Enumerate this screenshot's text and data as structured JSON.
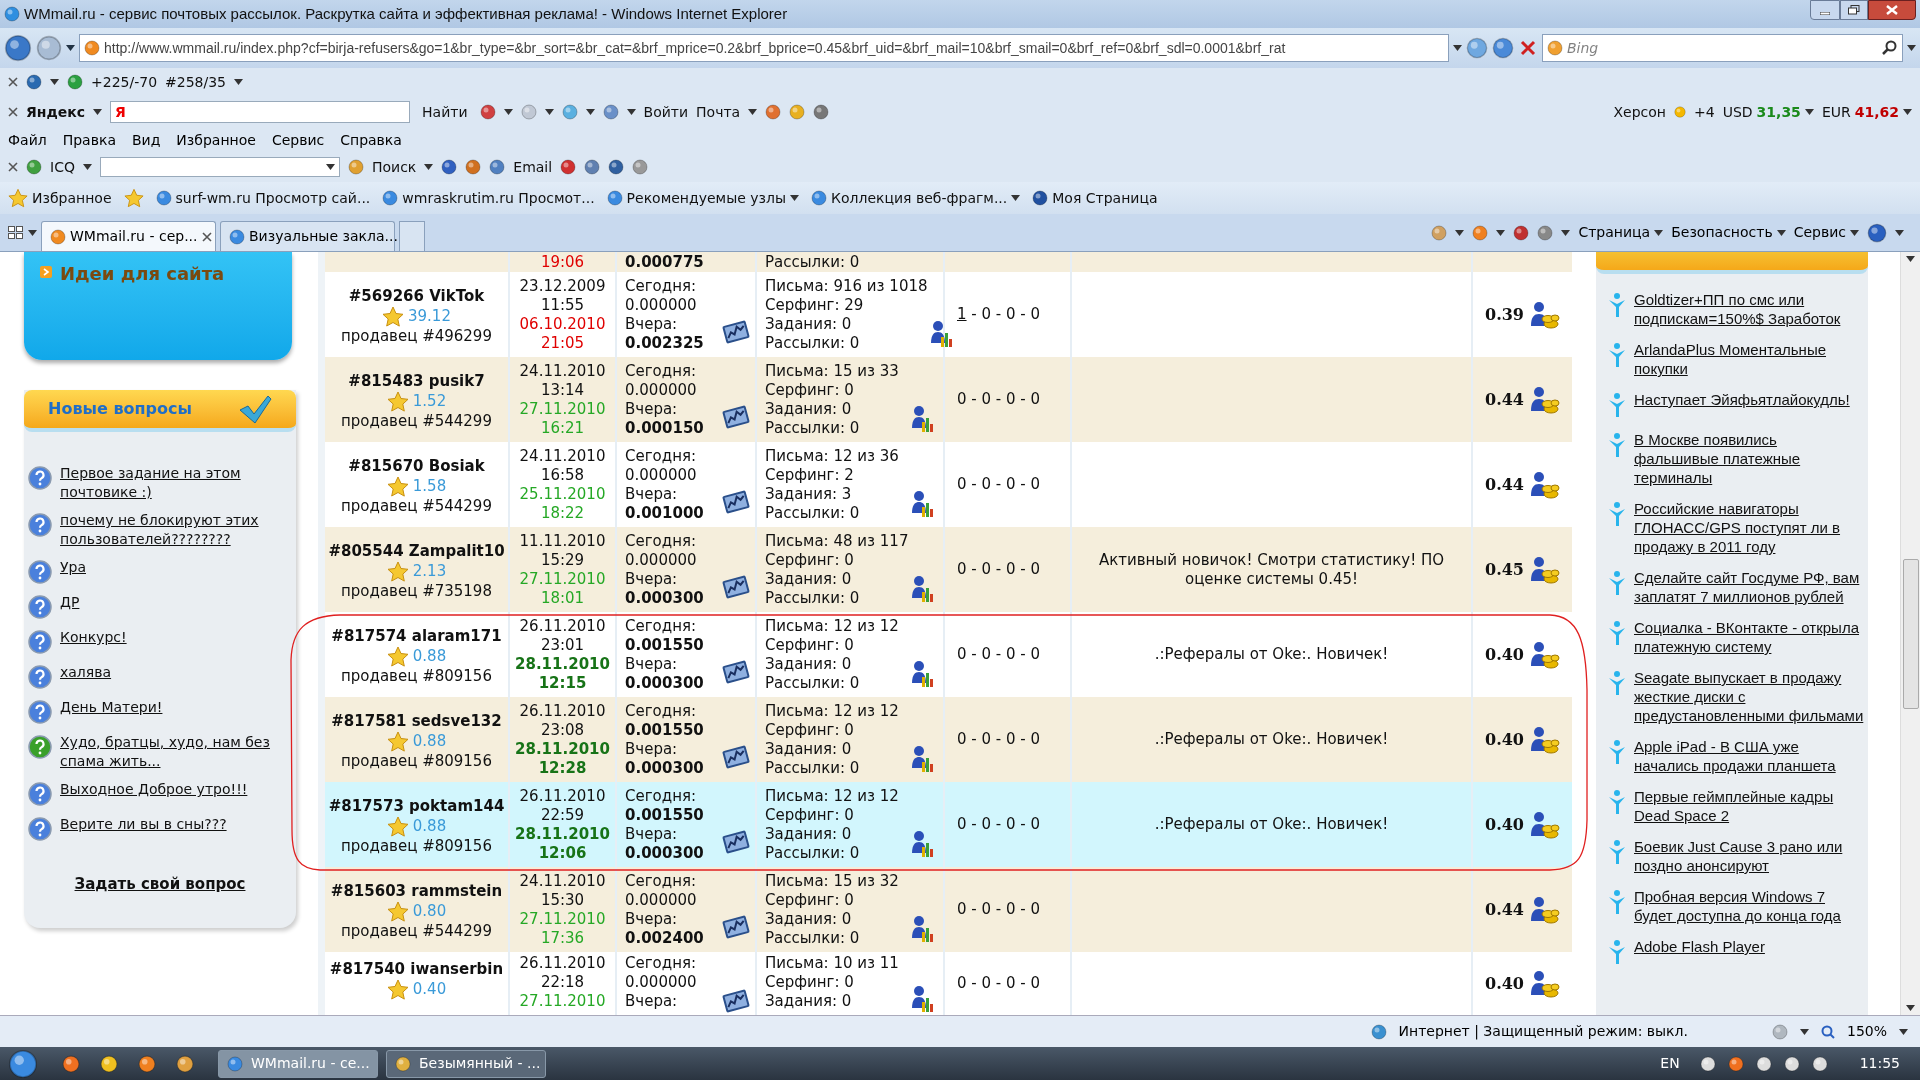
{
  "window": {
    "title": "WMmail.ru - сервис почтовых рассылок. Раскрутка сайта и эффективная реклама! - Windows Internet Explorer"
  },
  "address_bar": {
    "url": "http://www.wmmail.ru/index.php?cf=birja-refusers&go=1&br_type=&br_sort=&br_cat=&brf_mprice=0.2&brf_bprice=0.45&brf_uid=&brf_mail=10&brf_smail=0&brf_ref=0&brf_sdl=0.0001&brf_rat",
    "search_placeholder": "Bing"
  },
  "counter_bar": {
    "counters": [
      "+225/-70",
      "#258/35"
    ]
  },
  "yandex_bar": {
    "logo": "Яндекс",
    "field_logo": "Я",
    "search_button": "Найти",
    "buttons": [
      "Войти",
      "Почта"
    ],
    "city": "Херсон",
    "weather": "+4",
    "currencies": [
      {
        "code": "USD",
        "value": "31,35",
        "color": "#1a8a1a"
      },
      {
        "code": "EUR",
        "value": "41,62",
        "color": "#c00000"
      }
    ]
  },
  "menu": [
    "Файл",
    "Правка",
    "Вид",
    "Избранное",
    "Сервис",
    "Справка"
  ],
  "icq_bar": {
    "label": "ICQ",
    "search": "Поиск",
    "email": "Email"
  },
  "favorites_bar": {
    "label": "Избранное",
    "items": [
      {
        "text": "surf-wm.ru Просмотр сай...",
        "dropdown": false
      },
      {
        "text": "wmraskrutim.ru Просмот...",
        "dropdown": false
      },
      {
        "text": "Рекомендуемые узлы",
        "dropdown": true
      },
      {
        "text": "Коллекция веб-фрагм...",
        "dropdown": true
      },
      {
        "text": "Моя Страница",
        "dropdown": false
      }
    ]
  },
  "tabs": [
    {
      "label": "WMmail.ru - сер...",
      "selected": true
    },
    {
      "label": "Визуальные закла...",
      "selected": false
    }
  ],
  "command_bar": [
    "Страница",
    "Безопасность",
    "Сервис"
  ],
  "left_sidebar": {
    "banner": "Идеи для сайта",
    "questions": {
      "title": "Новые вопросы",
      "items": [
        {
          "text": "Первое задание на этом почтовике :)",
          "color": "#4a80dc"
        },
        {
          "text": "почему не блокируют этих пользователей????????",
          "color": "#4a80dc"
        },
        {
          "text": "Ура",
          "color": "#4a80dc"
        },
        {
          "text": "ДР",
          "color": "#4a80dc"
        },
        {
          "text": "Конкурс!",
          "color": "#4a80dc"
        },
        {
          "text": "халява",
          "color": "#4a80dc"
        },
        {
          "text": "День Матери!",
          "color": "#4a80dc"
        },
        {
          "text": "Худо, братцы, худо, нам без спама жить...",
          "color": "#3aa02a"
        },
        {
          "text": "Выходное Доброе утро!!!",
          "color": "#4a80dc"
        },
        {
          "text": "Верите ли вы в сны???",
          "color": "#4a80dc"
        }
      ],
      "ask_link": "Задать свой вопрос"
    }
  },
  "table": {
    "rows": [
      {
        "kind": "top",
        "selected": false,
        "last": [
          "19:06"
        ],
        "color": "#e00000",
        "last_bold": false,
        "yesterday": "0.000775",
        "letters": [
          "Рассылки: 0"
        ]
      },
      {
        "kind": "full",
        "selected": false,
        "user": "#569266 VikTok",
        "rating": "39.12",
        "seller": "продавец #496299",
        "created": [
          "23.12.2009",
          "11:55"
        ],
        "last": [
          "06.10.2010",
          "21:05"
        ],
        "color": "#e00000",
        "last_bold": false,
        "today_label": "Сегодня:",
        "today": "0.000000",
        "today_bold": false,
        "yesterday_label": "Вчера:",
        "yesterday": "0.002325",
        "letters": [
          "Письма: 916 из 1018",
          "Серфинг: 29",
          "Задания: 0",
          "Рассылки: 0"
        ],
        "stats": {
          "link": "1",
          "rest": " - 0 - 0 - 0"
        },
        "price": "0.39"
      },
      {
        "kind": "full",
        "selected": false,
        "user": "#815483 pusik7",
        "rating": "1.52",
        "seller": "продавец #544299",
        "created": [
          "24.11.2010",
          "13:14"
        ],
        "last": [
          "27.11.2010",
          "16:21"
        ],
        "color": "#25a825",
        "last_bold": false,
        "today_label": "Сегодня:",
        "today": "0.000000",
        "today_bold": false,
        "yesterday_label": "Вчера:",
        "yesterday": "0.000150",
        "letters": [
          "Письма: 15 из 33",
          "Серфинг: 0",
          "Задания: 0",
          "Рассылки: 0"
        ],
        "stats": {
          "rest": "0 - 0 - 0 - 0"
        },
        "price": "0.44"
      },
      {
        "kind": "full",
        "selected": false,
        "user": "#815670 Bosiak",
        "rating": "1.58",
        "seller": "продавец #544299",
        "created": [
          "24.11.2010",
          "16:58"
        ],
        "last": [
          "25.11.2010",
          "18:22"
        ],
        "color": "#25a825",
        "last_bold": false,
        "today_label": "Сегодня:",
        "today": "0.000000",
        "today_bold": false,
        "yesterday_label": "Вчера:",
        "yesterday": "0.001000",
        "letters": [
          "Письма: 12 из 36",
          "Серфинг: 2",
          "Задания: 3",
          "Рассылки: 0"
        ],
        "stats": {
          "rest": "0 - 0 - 0 - 0"
        },
        "price": "0.44"
      },
      {
        "kind": "full",
        "selected": false,
        "user": "#805544 Zampalit10",
        "rating": "2.13",
        "seller": "продавец #735198",
        "created": [
          "11.11.2010",
          "15:29"
        ],
        "last": [
          "27.11.2010",
          "18:01"
        ],
        "color": "#25a825",
        "last_bold": false,
        "today_label": "Сегодня:",
        "today": "0.000000",
        "today_bold": false,
        "yesterday_label": "Вчера:",
        "yesterday": "0.000300",
        "letters": [
          "Письма: 48 из 117",
          "Серфинг: 0",
          "Задания: 0",
          "Рассылки: 0"
        ],
        "stats": {
          "rest": "0 - 0 - 0 - 0"
        },
        "comment": "Активный новичок! Смотри статистику! ПО оценке системы 0.45!",
        "price": "0.45"
      },
      {
        "kind": "full",
        "selected": false,
        "user": "#817574 alaram171",
        "rating": "0.88",
        "seller": "продавец #809156",
        "created": [
          "26.11.2010",
          "23:01"
        ],
        "last": [
          "28.11.2010",
          "12:15"
        ],
        "color": "#177317",
        "last_bold": true,
        "today_label": "Сегодня:",
        "today": "0.001550",
        "today_bold": true,
        "yesterday_label": "Вчера:",
        "yesterday": "0.000300",
        "letters": [
          "Письма: 12 из 12",
          "Серфинг: 0",
          "Задания: 0",
          "Рассылки: 0"
        ],
        "stats": {
          "rest": "0 - 0 - 0 - 0"
        },
        "comment": ".:Рефералы от Oke:. Новичек!",
        "price": "0.40"
      },
      {
        "kind": "full",
        "selected": false,
        "user": "#817581 sedsve132",
        "rating": "0.88",
        "seller": "продавец #809156",
        "created": [
          "26.11.2010",
          "23:08"
        ],
        "last": [
          "28.11.2010",
          "12:28"
        ],
        "color": "#177317",
        "last_bold": true,
        "today_label": "Сегодня:",
        "today": "0.001550",
        "today_bold": true,
        "yesterday_label": "Вчера:",
        "yesterday": "0.000300",
        "letters": [
          "Письма: 12 из 12",
          "Серфинг: 0",
          "Задания: 0",
          "Рассылки: 0"
        ],
        "stats": {
          "rest": "0 - 0 - 0 - 0"
        },
        "comment": ".:Рефералы от Oke:. Новичек!",
        "price": "0.40"
      },
      {
        "kind": "full",
        "selected": true,
        "user": "#817573 poktam144",
        "rating": "0.88",
        "seller": "продавец #809156",
        "created": [
          "26.11.2010",
          "22:59"
        ],
        "last": [
          "28.11.2010",
          "12:06"
        ],
        "color": "#177317",
        "last_bold": true,
        "today_label": "Сегодня:",
        "today": "0.001550",
        "today_bold": true,
        "yesterday_label": "Вчера:",
        "yesterday": "0.000300",
        "letters": [
          "Письма: 12 из 12",
          "Серфинг: 0",
          "Задания: 0",
          "Рассылки: 0"
        ],
        "stats": {
          "rest": "0 - 0 - 0 - 0"
        },
        "comment": ".:Рефералы от Oke:. Новичек!",
        "price": "0.40"
      },
      {
        "kind": "full",
        "selected": false,
        "user": "#815603 rammstein",
        "rating": "0.80",
        "seller": "продавец #544299",
        "created": [
          "24.11.2010",
          "15:30"
        ],
        "last": [
          "27.11.2010",
          "17:36"
        ],
        "color": "#25a825",
        "last_bold": false,
        "today_label": "Сегодня:",
        "today": "0.000000",
        "today_bold": false,
        "yesterday_label": "Вчера:",
        "yesterday": "0.002400",
        "letters": [
          "Письма: 15 из 32",
          "Серфинг: 0",
          "Задания: 0",
          "Рассылки: 0"
        ],
        "stats": {
          "rest": "0 - 0 - 0 - 0"
        },
        "price": "0.44"
      },
      {
        "kind": "bottom",
        "selected": false,
        "user": "#817540 iwanserbin",
        "rating": "0.40",
        "created": [
          "26.11.2010",
          "22:18"
        ],
        "last": [
          "27.11.2010"
        ],
        "color": "#25a825",
        "last_bold": false,
        "today_label": "Сегодня:",
        "today": "0.000000",
        "today_bold": false,
        "yesterday_label": "Вчера:",
        "letters": [
          "Письма: 10 из 11",
          "Серфинг: 0",
          "Задания: 0"
        ],
        "stats": {
          "rest": "0 - 0 - 0 - 0"
        },
        "price": "0.40"
      }
    ]
  },
  "right_sidebar": {
    "blog_items": [
      "Goldtizer+ПП по смс или подпискам=150%$ Заработок",
      "ArlandaPlus Моментальные покупки",
      "Наступает Эйяфьятлайокудль!",
      "В Москве появились фальшивые платежные терминалы",
      "Российские навигаторы ГЛОНАСС/GPS поступят ли в продажу в 2011 году",
      "Сделайте сайт Госдуме РФ, вам заплатят 7 миллионов рублей",
      "Социалка - ВКонтакте - открыла платежную систему",
      "Seagate выпускает в продажу жесткие диски с предустановленными фильмами",
      "Apple iPad - В США уже начались продажи планшета",
      "Первые геймплейные кадры Dead Space 2",
      "Боевик Just Cause 3 рано или поздно анонсируют",
      "Пробная версия Windows 7 будет доступна до конца года",
      "Adobe Flash Player"
    ]
  },
  "status_bar": {
    "zone": "Интернет | Защищенный режим: выкл.",
    "zoom": "150%"
  },
  "taskbar": {
    "tasks": [
      {
        "label": "WMmail.ru - се...",
        "selected": true
      },
      {
        "label": "Безымянный - ...",
        "selected": false
      }
    ],
    "language": "EN",
    "time": "11:55"
  }
}
